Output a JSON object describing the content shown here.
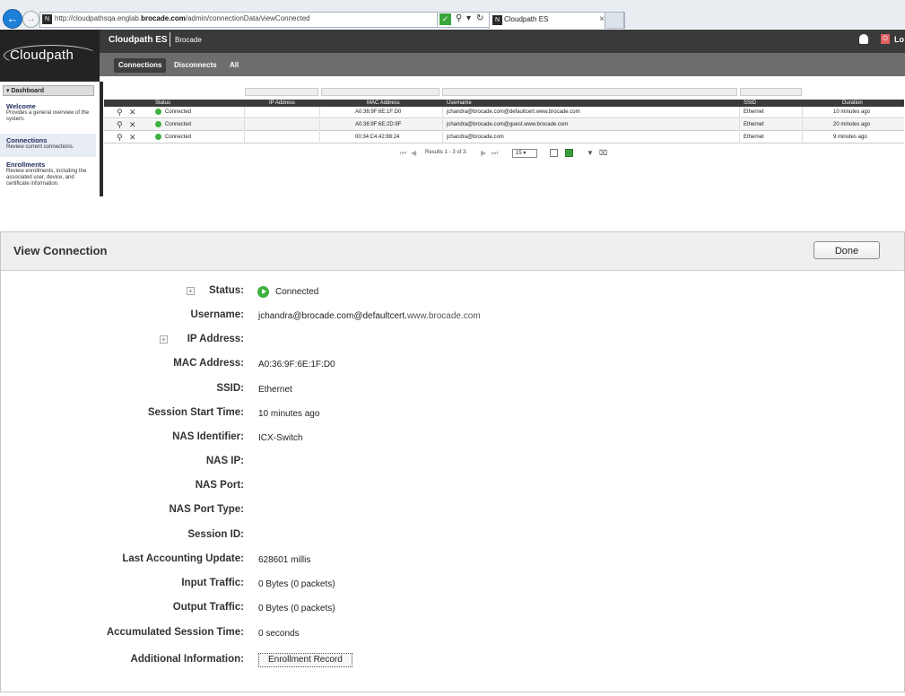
{
  "browser": {
    "url_prefix": "http://cloudpathsqa.englab.",
    "url_domain": "brocade.com",
    "url_suffix": "/admin/connectionData/viewConnected",
    "tab_title": "Cloudpath ES",
    "favicon_text": "N"
  },
  "app": {
    "logo": "Cloudpath",
    "name": "Cloudpath ES",
    "org": "Brocade",
    "logout": "Lo"
  },
  "nav_tabs": [
    {
      "label": "Connections",
      "active": true
    },
    {
      "label": "Disconnects",
      "active": false
    },
    {
      "label": "All",
      "active": false
    }
  ],
  "sidebar": {
    "header": "▾ Dashboard",
    "items": [
      {
        "title": "Welcome",
        "desc": "Provides a general overview of the system."
      },
      {
        "title": "Connections",
        "desc": "Review current connections."
      },
      {
        "title": "Enrollments",
        "desc": "Review enrollments, including the associated user, device, and certificate information."
      }
    ]
  },
  "table": {
    "columns": [
      "Status",
      "IP Address",
      "MAC Address",
      "Username",
      "SSID",
      "Duration"
    ],
    "rows": [
      {
        "status": "Connected",
        "ip": "",
        "mac": "A0:36:9F:6E:1F:D0",
        "user": "jchandra@brocade.com@defaultcert.www.brocade.com",
        "ssid": "Ethernet",
        "duration": "10 minutes ago"
      },
      {
        "status": "Connected",
        "ip": "",
        "mac": "A0:36:9F:6E:2D:9F",
        "user": "jchandra@brocade.com@guest.www.brocade.com",
        "ssid": "Ethernet",
        "duration": "20 minutes ago"
      },
      {
        "status": "Connected",
        "ip": "",
        "mac": "00:34:C4:42:88:24",
        "user": "jchandra@brocade.com",
        "ssid": "Ethernet",
        "duration": "9 minutes ago"
      }
    ],
    "results_text": "Results 1 - 3 of 3.",
    "page_size": "15"
  },
  "panel": {
    "title": "View Connection",
    "done_label": "Done",
    "fields": [
      {
        "label": "Status:",
        "value": "Connected"
      },
      {
        "label": "Username:",
        "value": "jchandra@brocade.com@defaultcert.",
        "value_domain": "www.brocade.com"
      },
      {
        "label": "IP Address:",
        "value": ""
      },
      {
        "label": "MAC Address:",
        "value": "A0:36:9F:6E:1F:D0"
      },
      {
        "label": "SSID:",
        "value": "Ethernet"
      },
      {
        "label": "Session Start Time:",
        "value": "10 minutes ago"
      },
      {
        "label": "NAS Identifier:",
        "value": "ICX-Switch"
      },
      {
        "label": "NAS IP:",
        "value": ""
      },
      {
        "label": "NAS Port:",
        "value": ""
      },
      {
        "label": "NAS Port Type:",
        "value": ""
      },
      {
        "label": "Session ID:",
        "value": ""
      },
      {
        "label": "Last Accounting Update:",
        "value": "628601 millis"
      },
      {
        "label": "Input Traffic:",
        "value": "0 Bytes (0 packets)"
      },
      {
        "label": "Output Traffic:",
        "value": "0 Bytes (0 packets)"
      },
      {
        "label": "Accumulated Session Time:",
        "value": "0 seconds"
      },
      {
        "label": "Additional Information:",
        "button": "Enrollment Record"
      }
    ]
  }
}
